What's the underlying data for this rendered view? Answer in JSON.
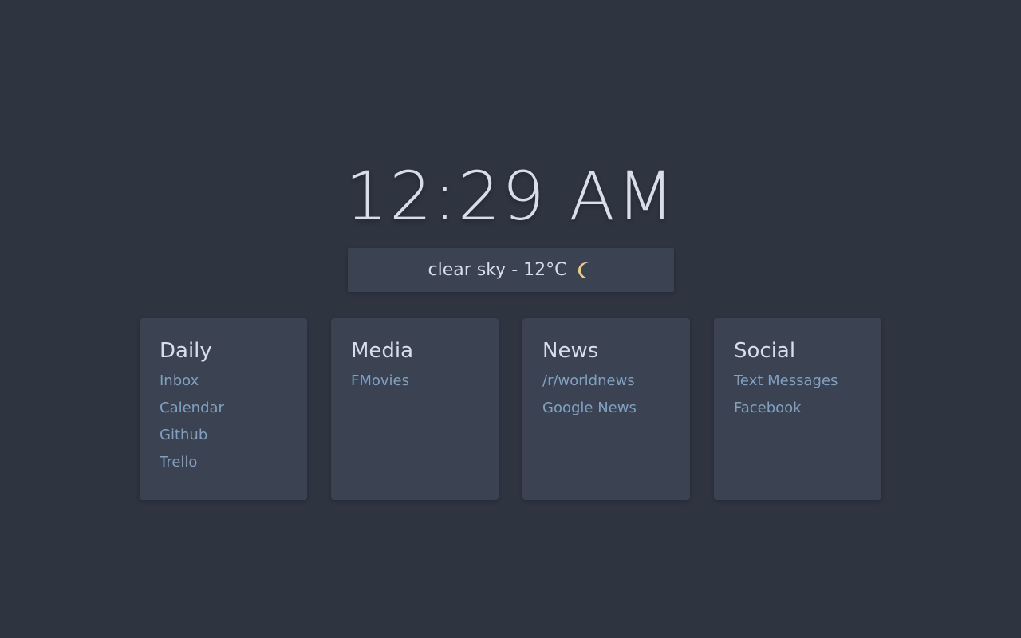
{
  "clock": {
    "time": "12:29 AM"
  },
  "weather": {
    "text": "clear sky - 12°C",
    "icon": "moon-icon",
    "icon_color": "#ebcb8b"
  },
  "theme": {
    "background": "#2e3440",
    "card": "#3b4252",
    "text": "#d8dee9",
    "link": "#81a1c1"
  },
  "cards": [
    {
      "title": "Daily",
      "links": [
        "Inbox",
        "Calendar",
        "Github",
        "Trello"
      ]
    },
    {
      "title": "Media",
      "links": [
        "FMovies"
      ]
    },
    {
      "title": "News",
      "links": [
        "/r/worldnews",
        "Google News"
      ]
    },
    {
      "title": "Social",
      "links": [
        "Text Messages",
        "Facebook"
      ]
    }
  ]
}
